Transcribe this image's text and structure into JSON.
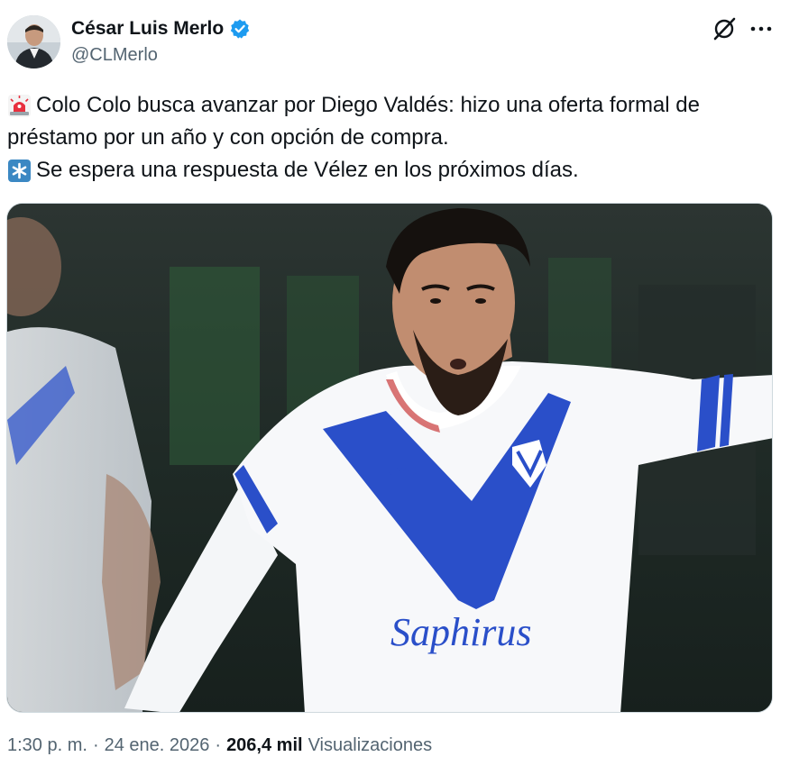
{
  "author": {
    "display_name": "César Luis Merlo",
    "handle": "@CLMerlo",
    "verified": true,
    "verified_color": "#1d9bf0"
  },
  "header_icons": {
    "grok": "grok-icon",
    "more": "more-icon"
  },
  "tweet": {
    "lines": [
      {
        "emoji": "rotating-light-icon",
        "text": "Colo Colo busca avanzar por Diego Valdés: hizo una oferta formal de"
      },
      {
        "emoji": "",
        "text": "préstamo por un año y con opción de compra."
      },
      {
        "emoji": "asterisk-icon",
        "text": "Se espera una respuesta de Vélez en los próximos días."
      }
    ]
  },
  "media": {
    "jersey_sponsor": "Saphirus"
  },
  "meta": {
    "time": "1:30 p. m.",
    "separator": "·",
    "date": "24 ene. 2026",
    "views_count": "206,4 mil",
    "views_label": "Visualizaciones"
  },
  "colors": {
    "text_primary": "#0f1419",
    "text_secondary": "#536471",
    "accent": "#1d9bf0",
    "jersey_blue": "#2a4fc9"
  }
}
